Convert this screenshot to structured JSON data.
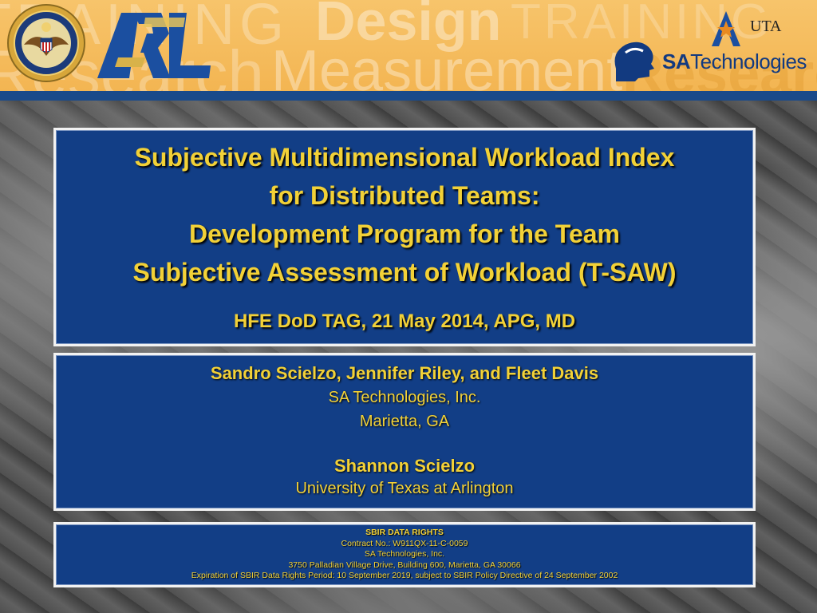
{
  "banner": {
    "bg_words": [
      "TRAINING",
      "Research",
      "Design",
      "TRAINING",
      "Measurement",
      "Research"
    ]
  },
  "logos": {
    "dod_seal": "dod-seal-icon",
    "arl": "arl-logo-icon",
    "uta_text": "UTA",
    "sat_bold": "SA",
    "sat_rest": "Technologies"
  },
  "title": {
    "lines": [
      "Subjective Multidimensional Workload Index",
      "for Distributed Teams:",
      "Development Program for the Team",
      "Subjective Assessment of Workload (T-SAW)"
    ],
    "event": "HFE DoD TAG, 21 May 2014, APG, MD"
  },
  "authors": {
    "names": "Sandro Scielzo, Jennifer Riley, and Fleet Davis",
    "org": "SA Technologies, Inc.",
    "city": "Marietta, GA",
    "second_name": "Shannon Scielzo",
    "second_org": "University of Texas at Arlington"
  },
  "rights": {
    "header": "SBIR DATA RIGHTS",
    "contract": "Contract No.: W911QX-11-C-0059",
    "company": "SA Technologies, Inc.",
    "address": "3750 Palladian Village Drive, Building 600, Marietta, GA 30066",
    "expiration": "Expiration of SBIR Data Rights Period: 10 September 2019, subject to SBIR Policy Directive of 24 September 2002"
  },
  "colors": {
    "banner": "#f3b552",
    "panel_blue": "#123e86",
    "title_yellow": "#f2d137",
    "sat_blue": "#123a80"
  }
}
